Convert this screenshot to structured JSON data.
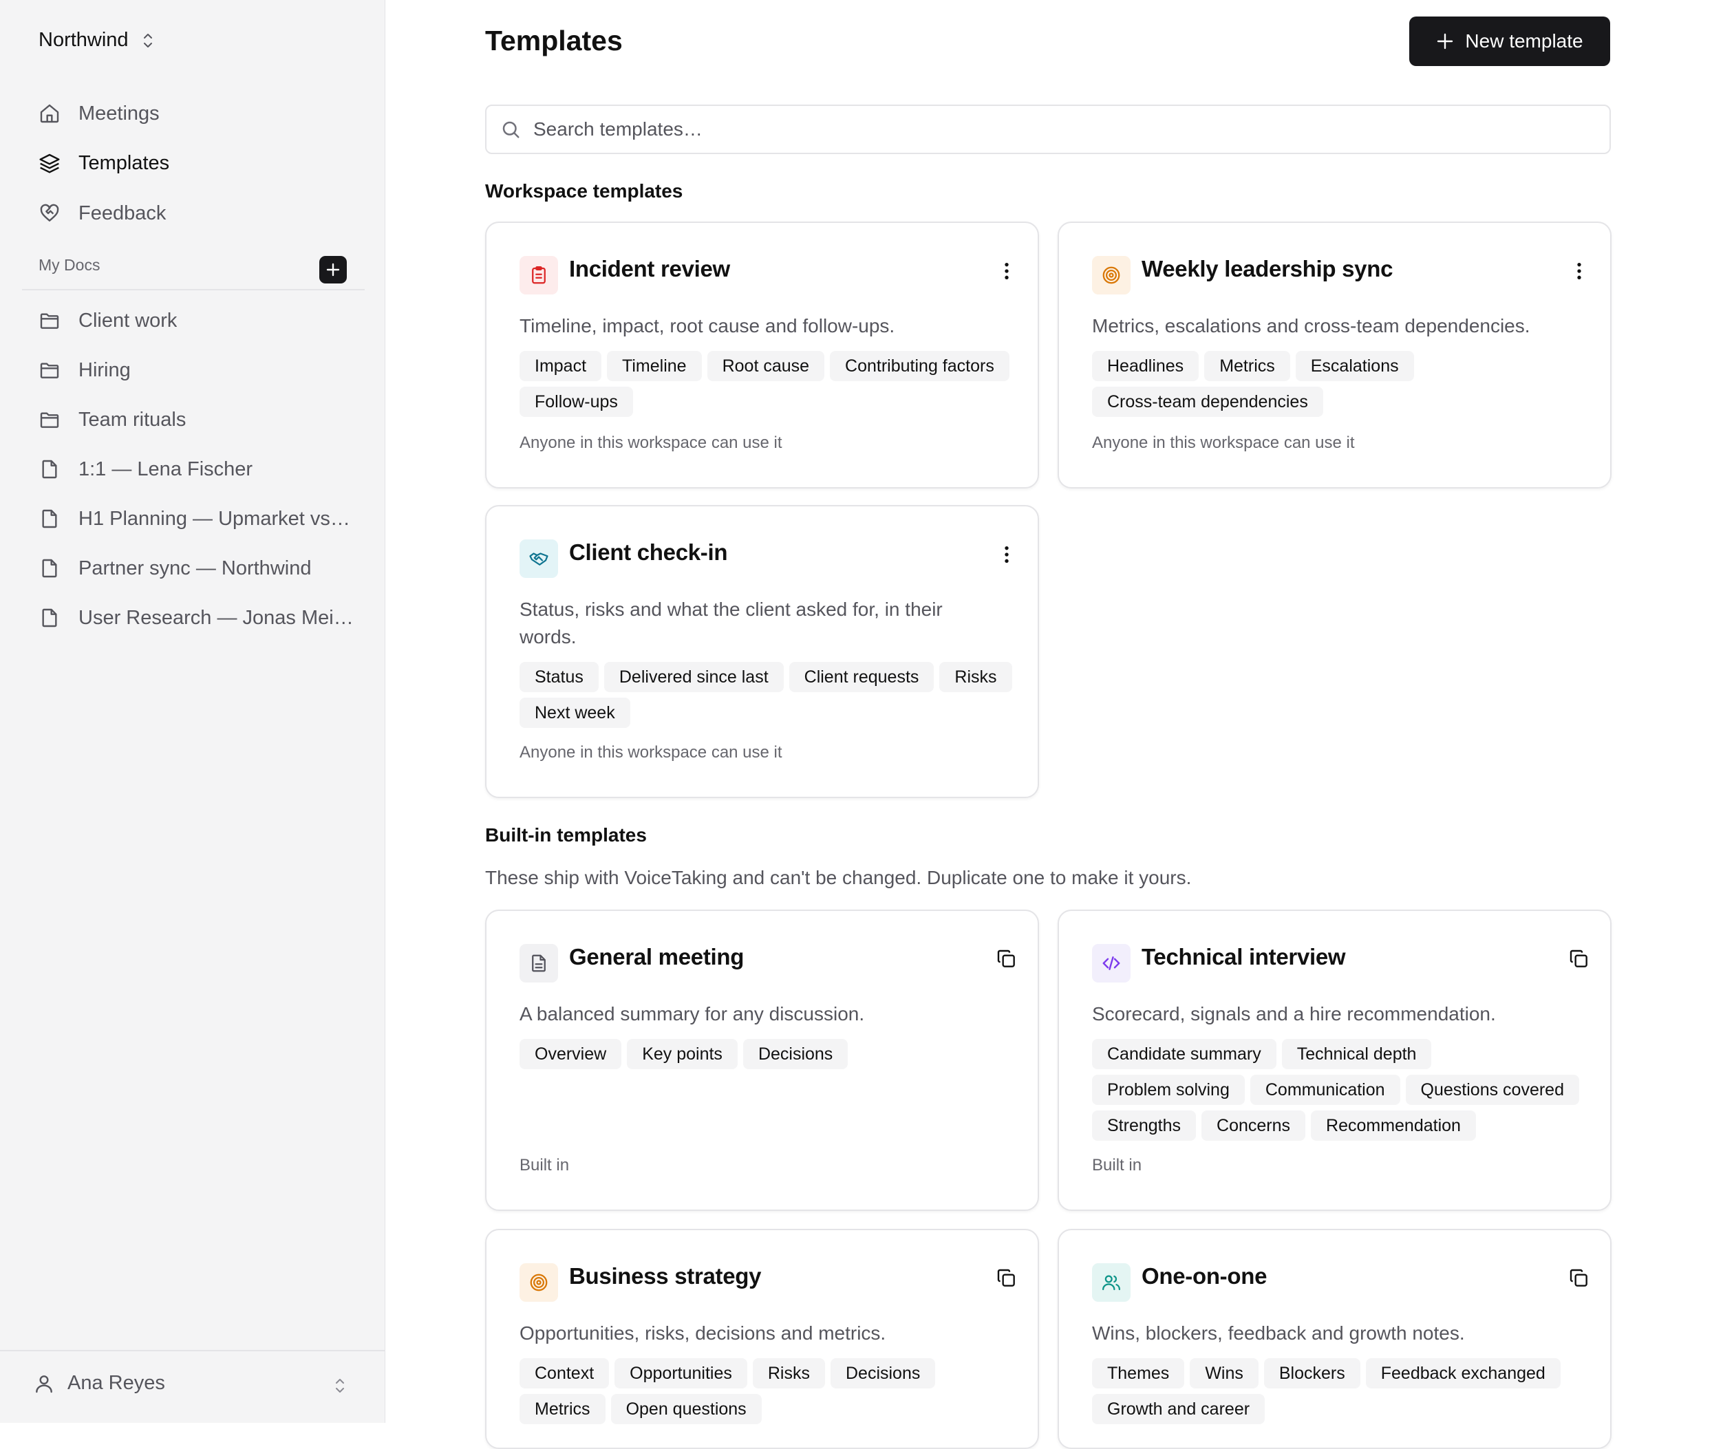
{
  "sidebar": {
    "workspace": "Northwind",
    "nav": [
      {
        "label": "Meetings",
        "icon": "home-icon"
      },
      {
        "label": "Templates",
        "icon": "layers-icon",
        "active": true
      },
      {
        "label": "Feedback",
        "icon": "heart-handshake-icon"
      }
    ],
    "my_docs_label": "My Docs",
    "docs": [
      {
        "label": "Client work",
        "icon": "folder-icon"
      },
      {
        "label": "Hiring",
        "icon": "folder-icon"
      },
      {
        "label": "Team rituals",
        "icon": "folder-icon"
      },
      {
        "label": "1:1 — Lena Fischer",
        "icon": "file-icon"
      },
      {
        "label": "H1 Planning — Upmarket vs …",
        "icon": "file-icon"
      },
      {
        "label": "Partner sync — Northwind",
        "icon": "file-icon"
      },
      {
        "label": "User Research — Jonas Meij…",
        "icon": "file-icon"
      }
    ],
    "user_name": "Ana Reyes"
  },
  "main": {
    "title": "Templates",
    "new_button": "New template",
    "search_placeholder": "Search templates…",
    "workspace_heading": "Workspace templates",
    "builtin_heading": "Built-in templates",
    "builtin_desc": "These ship with VoiceTaking and can't be changed. Duplicate one to make it yours."
  },
  "workspace_templates": [
    {
      "title": "Incident review",
      "desc": "Timeline, impact, root cause and follow-ups.",
      "tags": [
        "Impact",
        "Timeline",
        "Root cause",
        "Contributing factors",
        "Follow-ups"
      ],
      "footer": "Anyone in this workspace can use it",
      "icon": "clipboard-icon",
      "accent": "#dc2626",
      "accent_bg": "#fdecec"
    },
    {
      "title": "Weekly leadership sync",
      "desc": "Metrics, escalations and cross-team dependencies.",
      "tags": [
        "Headlines",
        "Metrics",
        "Escalations",
        "Cross-team dependencies"
      ],
      "footer": "Anyone in this workspace can use it",
      "icon": "target-icon",
      "accent": "#d97706",
      "accent_bg": "#fdf1e3"
    },
    {
      "title": "Client check-in",
      "desc": "Status, risks and what the client asked for, in their words.",
      "tags": [
        "Status",
        "Delivered since last",
        "Client requests",
        "Risks",
        "Next week"
      ],
      "footer": "Anyone in this workspace can use it",
      "icon": "handshake-icon",
      "accent": "#0e7490",
      "accent_bg": "#e3f4f7"
    }
  ],
  "builtin_templates": [
    {
      "title": "General meeting",
      "desc": "A balanced summary for any discussion.",
      "tags": [
        "Overview",
        "Key points",
        "Decisions"
      ],
      "footer": "Built in",
      "icon": "document-icon",
      "accent": "#52525b",
      "accent_bg": "#f1f1f3"
    },
    {
      "title": "Technical interview",
      "desc": "Scorecard, signals and a hire recommendation.",
      "tags": [
        "Candidate summary",
        "Technical depth",
        "Problem solving",
        "Communication",
        "Questions covered",
        "Strengths",
        "Concerns",
        "Recommendation"
      ],
      "footer": "Built in",
      "icon": "code-icon",
      "accent": "#7c3aed",
      "accent_bg": "#f2effc"
    },
    {
      "title": "Business strategy",
      "desc": "Opportunities, risks, decisions and metrics.",
      "tags": [
        "Context",
        "Opportunities",
        "Risks",
        "Decisions",
        "Metrics",
        "Open questions"
      ],
      "footer": "",
      "icon": "target-icon",
      "accent": "#d97706",
      "accent_bg": "#fdf1e3"
    },
    {
      "title": "One-on-one",
      "desc": "Wins, blockers, feedback and growth notes.",
      "tags": [
        "Themes",
        "Wins",
        "Blockers",
        "Feedback exchanged",
        "Growth and career"
      ],
      "footer": "",
      "icon": "users-icon",
      "accent": "#0d9488",
      "accent_bg": "#e4f5f3"
    }
  ]
}
